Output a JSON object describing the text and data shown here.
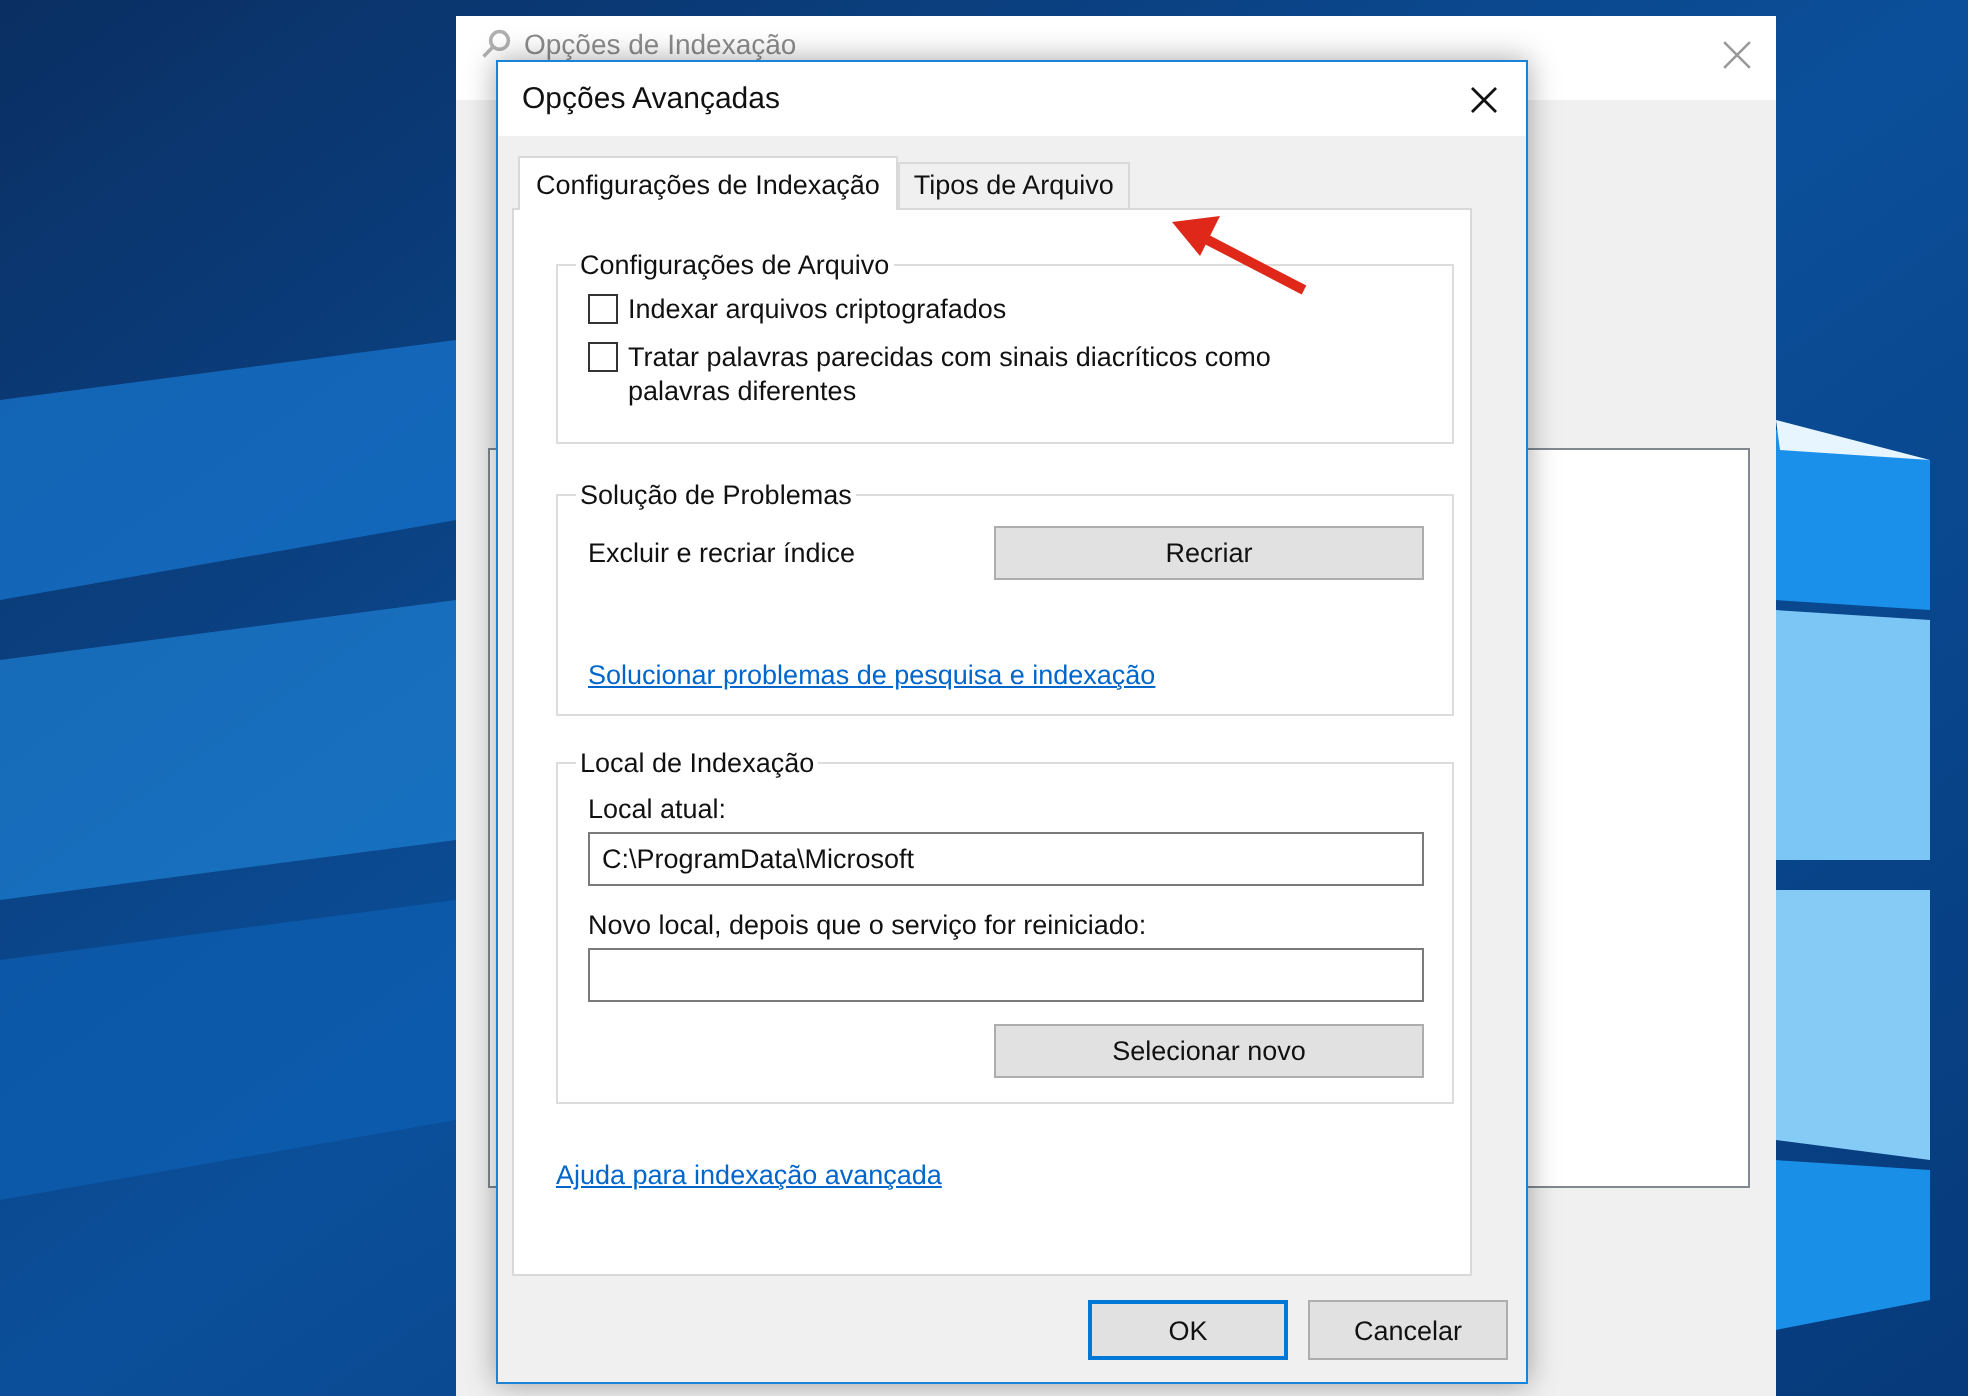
{
  "background_window": {
    "title": "Opções de Indexação"
  },
  "dialog": {
    "title": "Opções Avançadas",
    "tabs": [
      {
        "label": "Configurações de Indexação",
        "selected": true
      },
      {
        "label": "Tipos de Arquivo",
        "selected": false
      }
    ],
    "file_settings": {
      "title": "Configurações de Arquivo",
      "options": [
        {
          "label": "Indexar arquivos criptografados",
          "checked": false
        },
        {
          "label": "Tratar palavras parecidas com sinais diacríticos como palavras diferentes",
          "checked": false
        }
      ]
    },
    "troubleshooting": {
      "title": "Solução de Problemas",
      "rebuild_label": "Excluir e recriar índice",
      "rebuild_button": "Recriar",
      "link": "Solucionar problemas de pesquisa e indexação"
    },
    "index_location": {
      "title": "Local de Indexação",
      "current_label": "Local atual:",
      "current_value": "C:\\ProgramData\\Microsoft",
      "new_label": "Novo local, depois que o serviço for reiniciado:",
      "select_button": "Selecionar novo"
    },
    "help_link": "Ajuda para indexação avançada",
    "buttons": [
      {
        "label": "OK",
        "default": true
      },
      {
        "label": "Cancelar",
        "default": false
      }
    ]
  }
}
